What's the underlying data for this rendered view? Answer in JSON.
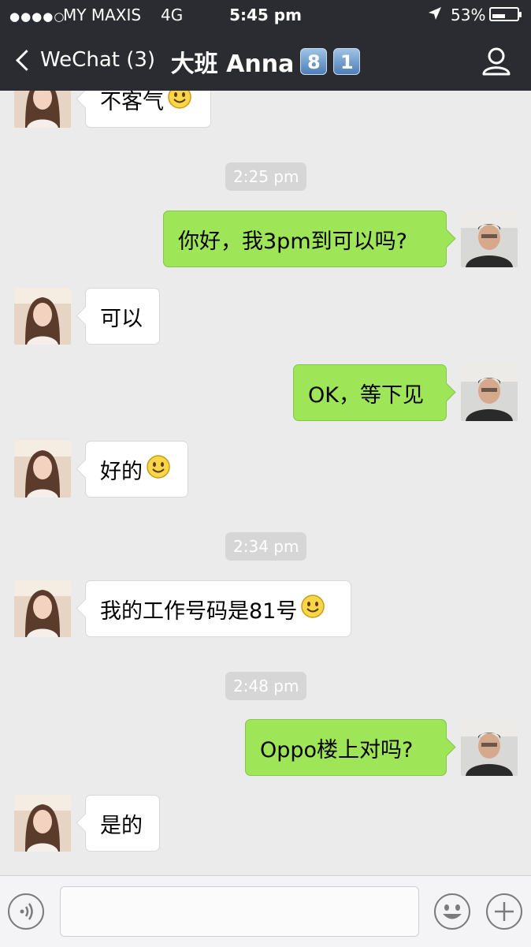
{
  "status_bar": {
    "signal": "●●●●○",
    "carrier": "MY MAXIS",
    "network": "4G",
    "time": "5:45 pm",
    "battery_percent": "53%",
    "battery_level": 0.53
  },
  "nav": {
    "back_label": "WeChat (3)",
    "title": "大班 Anna",
    "title_badges": [
      "8",
      "1"
    ]
  },
  "messages": [
    {
      "side": "left",
      "text": "不客气",
      "emoji": "smile-icon"
    },
    {
      "type": "time",
      "text": "2:25 pm"
    },
    {
      "side": "right",
      "text": "你好，我3pm到可以吗?"
    },
    {
      "side": "left",
      "text": "可以"
    },
    {
      "side": "right",
      "text": "OK，等下见"
    },
    {
      "side": "left",
      "text": "好的",
      "emoji": "smile-icon"
    },
    {
      "type": "time",
      "text": "2:34 pm"
    },
    {
      "side": "left",
      "text": "我的工作号码是81号",
      "emoji": "smile-icon"
    },
    {
      "type": "time",
      "text": "2:48 pm"
    },
    {
      "side": "right",
      "text": "Oppo楼上对吗?"
    },
    {
      "side": "left",
      "text": "是的"
    }
  ],
  "input": {
    "value": "",
    "placeholder": ""
  },
  "colors": {
    "header_bg": "#2b2c31",
    "chat_bg": "#ebebeb",
    "sent_bubble": "#9ee658",
    "received_bubble": "#ffffff",
    "timestamp_bg": "#d6d6d6"
  }
}
